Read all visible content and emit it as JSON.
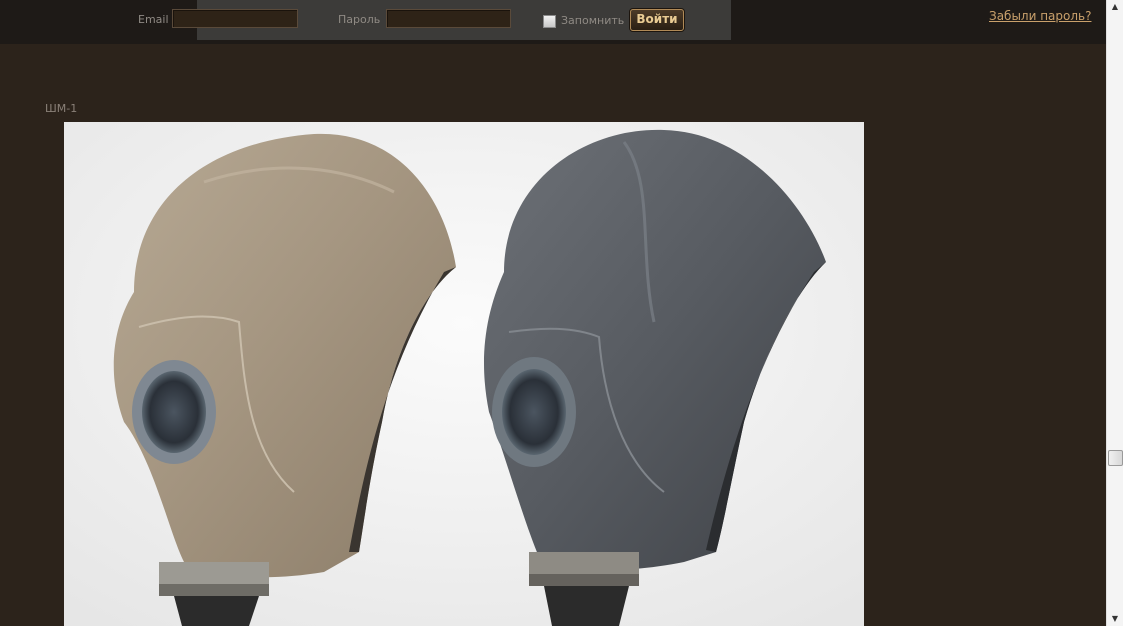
{
  "login": {
    "email_label": "Email",
    "email_value": "",
    "password_label": "Пароль",
    "password_value": "",
    "remember_label": "Запомнить",
    "remember_checked": false,
    "submit_label": "Войти",
    "forgot_label": "Забыли пароль?"
  },
  "content": {
    "caption": "ШМ-1",
    "photo_subject": "two ШМ-1 rubber gas mask helmets, tan and grey"
  },
  "colors": {
    "background": "#2c231b",
    "topbar": "#1e1a17",
    "panel": "#3c3b39",
    "accent": "#c9a06b"
  }
}
